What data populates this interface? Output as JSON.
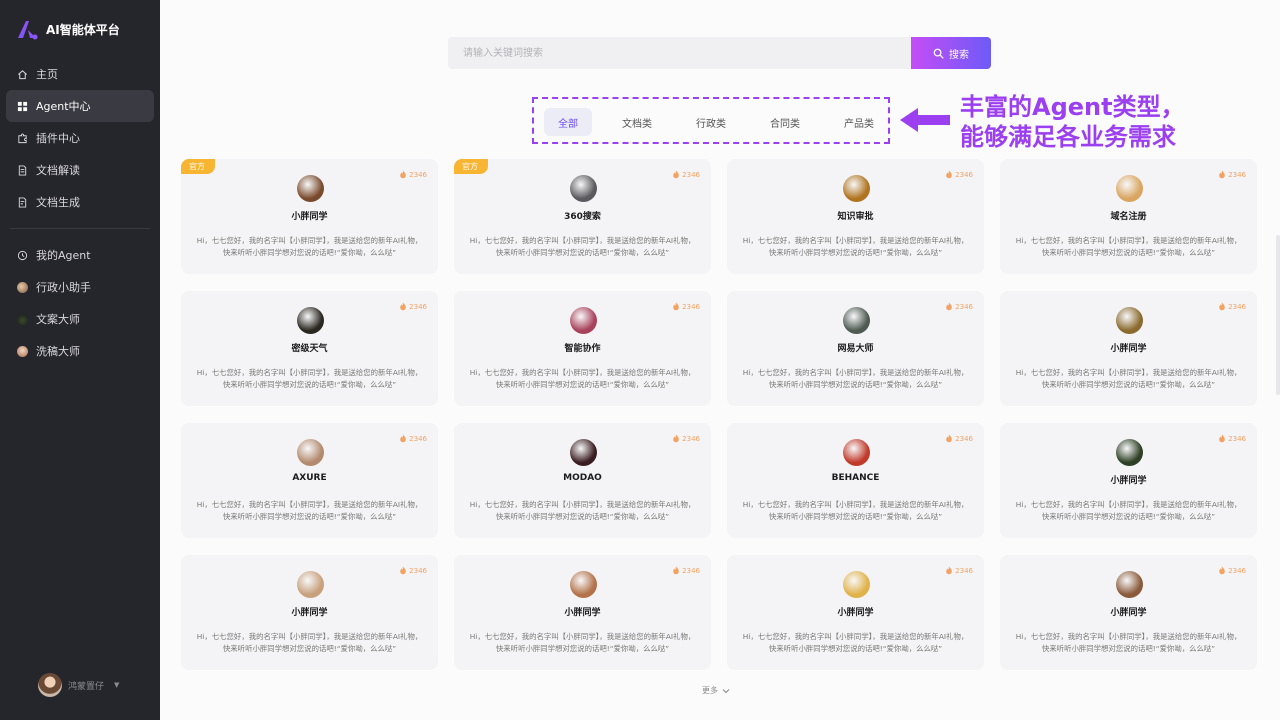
{
  "brand": {
    "title": "AI智能体平台"
  },
  "sidebar": {
    "nav": [
      {
        "label": "主页",
        "icon": "home-icon"
      },
      {
        "label": "Agent中心",
        "icon": "grid-icon",
        "active": true
      },
      {
        "label": "插件中心",
        "icon": "puzzle-icon"
      },
      {
        "label": "文档解读",
        "icon": "document-icon"
      },
      {
        "label": "文档生成",
        "icon": "document-edit-icon"
      }
    ],
    "my_agents": [
      {
        "label": "我的Agent",
        "icon": "clock-icon"
      },
      {
        "label": "行政小助手",
        "icon": "avatar"
      },
      {
        "label": "文案大师",
        "icon": "avatar"
      },
      {
        "label": "洗稿大师",
        "icon": "avatar"
      }
    ],
    "user": {
      "name": "鸿蒙置仔"
    }
  },
  "search": {
    "placeholder": "请输入关键词搜索",
    "button_label": "搜索"
  },
  "tabs": [
    {
      "label": "全部",
      "active": true
    },
    {
      "label": "文档类"
    },
    {
      "label": "行政类"
    },
    {
      "label": "合同类"
    },
    {
      "label": "产品类"
    }
  ],
  "annotation": {
    "line1": "丰富的Agent类型，",
    "line2": "能够满足各业务需求"
  },
  "cards": [
    {
      "title": "小胖同学",
      "badge": "官方",
      "count": "2346",
      "desc": "Hi，七七您好，我的名字叫【小胖同学】，我是送给您的新年AI礼物，快来听听小胖同学想对您说的话吧!“爱你呦，么么哒”",
      "avatar_color": "#7a4a2c"
    },
    {
      "title": "360搜索",
      "badge": "官方",
      "count": "2346",
      "desc": "Hi，七七您好，我的名字叫【小胖同学】，我是送给您的新年AI礼物，快来听听小胖同学想对您说的话吧!“爱你呦，么么哒”",
      "avatar_color": "#5a5a5e"
    },
    {
      "title": "知识审批",
      "badge": "",
      "count": "2346",
      "desc": "Hi，七七您好，我的名字叫【小胖同学】，我是送给您的新年AI礼物，快来听听小胖同学想对您说的话吧!“爱你呦，么么哒”",
      "avatar_color": "#b0741f"
    },
    {
      "title": "域名注册",
      "badge": "",
      "count": "2346",
      "desc": "Hi，七七您好，我的名字叫【小胖同学】，我是送给您的新年AI礼物，快来听听小胖同学想对您说的话吧!“爱你呦，么么哒”",
      "avatar_color": "#d9a560"
    },
    {
      "title": "密级天气",
      "badge": "",
      "count": "2346",
      "desc": "Hi，七七您好，我的名字叫【小胖同学】，我是送给您的新年AI礼物，快来听听小胖同学想对您说的话吧!“爱你呦，么么哒”",
      "avatar_color": "#2a2620"
    },
    {
      "title": "智能协作",
      "badge": "",
      "count": "2346",
      "desc": "Hi，七七您好，我的名字叫【小胖同学】，我是送给您的新年AI礼物，快来听听小胖同学想对您说的话吧!“爱你呦，么么哒”",
      "avatar_color": "#a8425a"
    },
    {
      "title": "网易大师",
      "badge": "",
      "count": "2346",
      "desc": "Hi，七七您好，我的名字叫【小胖同学】，我是送给您的新年AI礼物，快来听听小胖同学想对您说的话吧!“爱你呦，么么哒”",
      "avatar_color": "#4e5a52"
    },
    {
      "title": "小胖同学",
      "badge": "",
      "count": "2346",
      "desc": "Hi，七七您好，我的名字叫【小胖同学】，我是送给您的新年AI礼物，快来听听小胖同学想对您说的话吧!“爱你呦，么么哒”",
      "avatar_color": "#8a6a2e"
    },
    {
      "title": "AXURE",
      "badge": "",
      "count": "2346",
      "desc": "Hi，七七您好，我的名字叫【小胖同学】，我是送给您的新年AI礼物，快来听听小胖同学想对您说的话吧!“爱你呦，么么哒”",
      "avatar_color": "#b38a6e"
    },
    {
      "title": "MODAO",
      "badge": "",
      "count": "2346",
      "desc": "Hi，七七您好，我的名字叫【小胖同学】，我是送给您的新年AI礼物，快来听听小胖同学想对您说的话吧!“爱你呦，么么哒”",
      "avatar_color": "#3a1d20"
    },
    {
      "title": "BEHANCE",
      "badge": "",
      "count": "2346",
      "desc": "Hi，七七您好，我的名字叫【小胖同学】，我是送给您的新年AI礼物，快来听听小胖同学想对您说的话吧!“爱你呦，么么哒”",
      "avatar_color": "#c03a2a"
    },
    {
      "title": "小胖同学",
      "badge": "",
      "count": "2346",
      "desc": "Hi，七七您好，我的名字叫【小胖同学】，我是送给您的新年AI礼物，快来听听小胖同学想对您说的话吧!“爱你呦，么么哒”",
      "avatar_color": "#2d3f24"
    },
    {
      "title": "小胖同学",
      "badge": "",
      "count": "2346",
      "desc": "Hi，七七您好，我的名字叫【小胖同学】，我是送给您的新年AI礼物，快来听听小胖同学想对您说的话吧!“爱你呦，么么哒”",
      "avatar_color": "#c8a07c"
    },
    {
      "title": "小胖同学",
      "badge": "",
      "count": "2346",
      "desc": "Hi，七七您好，我的名字叫【小胖同学】，我是送给您的新年AI礼物，快来听听小胖同学想对您说的话吧!“爱你呦，么么哒”",
      "avatar_color": "#b3724a"
    },
    {
      "title": "小胖同学",
      "badge": "",
      "count": "2346",
      "desc": "Hi，七七您好，我的名字叫【小胖同学】，我是送给您的新年AI礼物，快来听听小胖同学想对您说的话吧!“爱你呦，么么哒”",
      "avatar_color": "#e0b24a"
    },
    {
      "title": "小胖同学",
      "badge": "",
      "count": "2346",
      "desc": "Hi，七七您好，我的名字叫【小胖同学】，我是送给您的新年AI礼物，快来听听小胖同学想对您说的话吧!“爱你呦，么么哒”",
      "avatar_color": "#8a5a3a"
    }
  ],
  "more_label": "更多",
  "colors": {
    "sidebar_bg": "#25262b",
    "accent_purple": "#9b3ff0",
    "search_gradient_start": "#c44df6",
    "search_gradient_end": "#6d5bf7",
    "official_badge": "#f7b531",
    "count_orange": "#f3a262"
  }
}
